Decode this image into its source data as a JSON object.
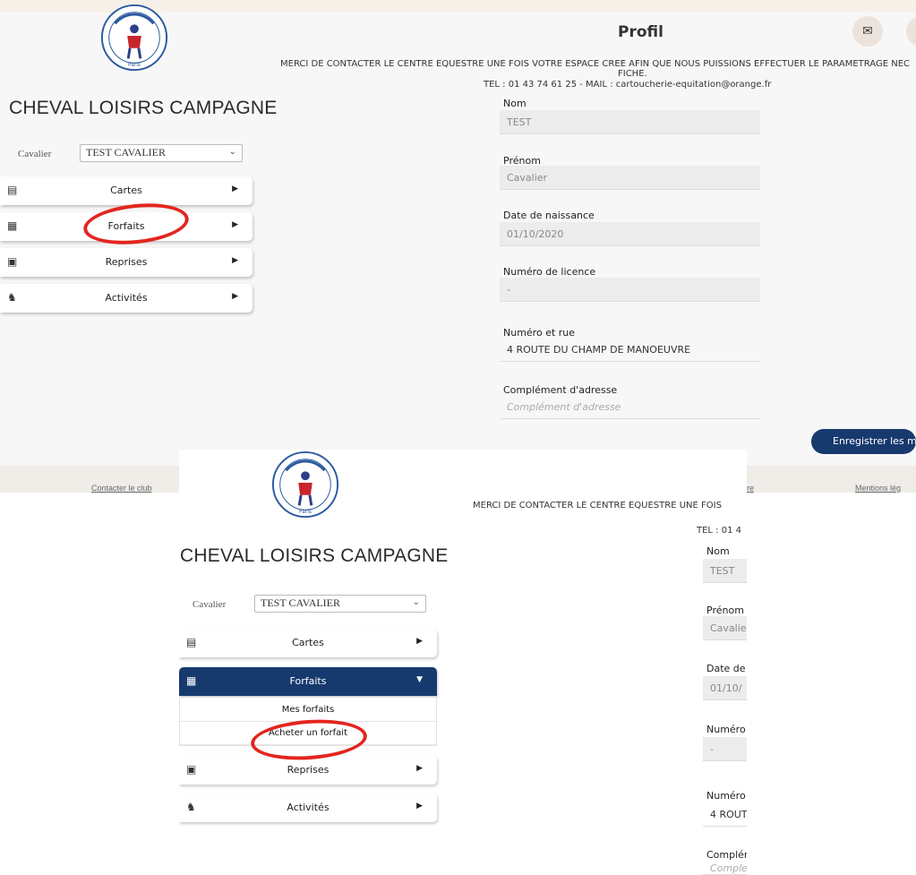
{
  "club": {
    "name": "CHEVAL LOISIRS CAMPAGNE",
    "logo_text": "C.L.C la Cartoucherie",
    "logo_sub": "Paris"
  },
  "rider": {
    "label": "Cavalier",
    "selected": "TEST CAVALIER"
  },
  "menu": {
    "items": [
      {
        "label": "Cartes",
        "icon": "document-icon"
      },
      {
        "label": "Forfaits",
        "icon": "calendar-grid-icon"
      },
      {
        "label": "Reprises",
        "icon": "calendar-day-icon"
      },
      {
        "label": "Activités",
        "icon": "horse-rider-icon"
      }
    ],
    "forfaits_submenu": [
      "Mes forfaits",
      "Acheter un forfait"
    ]
  },
  "profile": {
    "title": "Profil",
    "notice_line1": "MERCI DE CONTACTER LE CENTRE EQUESTRE UNE FOIS VOTRE ESPACE CREE AFIN QUE NOUS PUISSIONS EFFECTUER LE PARAMETRAGE NEC",
    "notice_line2": "FICHE.",
    "notice_line3": "TEL : 01 43 74 61 25 - MAIL : cartoucherie-equitation@orange.fr",
    "fields": [
      {
        "label": "Nom",
        "value": "TEST"
      },
      {
        "label": "Prénom",
        "value": "Cavalier"
      },
      {
        "label": "Date de naissance",
        "value": "01/10/2020"
      },
      {
        "label": "Numéro de licence",
        "value": "-"
      },
      {
        "label": "Numéro et rue",
        "value": "4 ROUTE DU CHAMP DE MANOEUVRE"
      },
      {
        "label": "Complément d'adresse",
        "placeholder": "Complément d'adresse"
      }
    ],
    "save_label": "Enregistrer les m"
  },
  "shot2": {
    "notice": "MERCI DE CONTACTER LE CENTRE EQUESTRE UNE FOIS",
    "tel": "TEL : 01 4",
    "fields": [
      {
        "label": "Nom",
        "value": "TEST"
      },
      {
        "label": "Prénom",
        "value": "Cavalie"
      },
      {
        "label": "Date de",
        "value": "01/10/"
      },
      {
        "label": "Numéro",
        "value": "-"
      },
      {
        "label": "Numéro",
        "value": "4 ROUT"
      },
      {
        "label": "Complér",
        "value": "Comple"
      }
    ]
  },
  "footer": {
    "contact": "Contacter le club",
    "partial": "re",
    "legal": "Mentions lég"
  },
  "colors": {
    "accent": "#173a6e",
    "annotation": "#e3251e"
  }
}
